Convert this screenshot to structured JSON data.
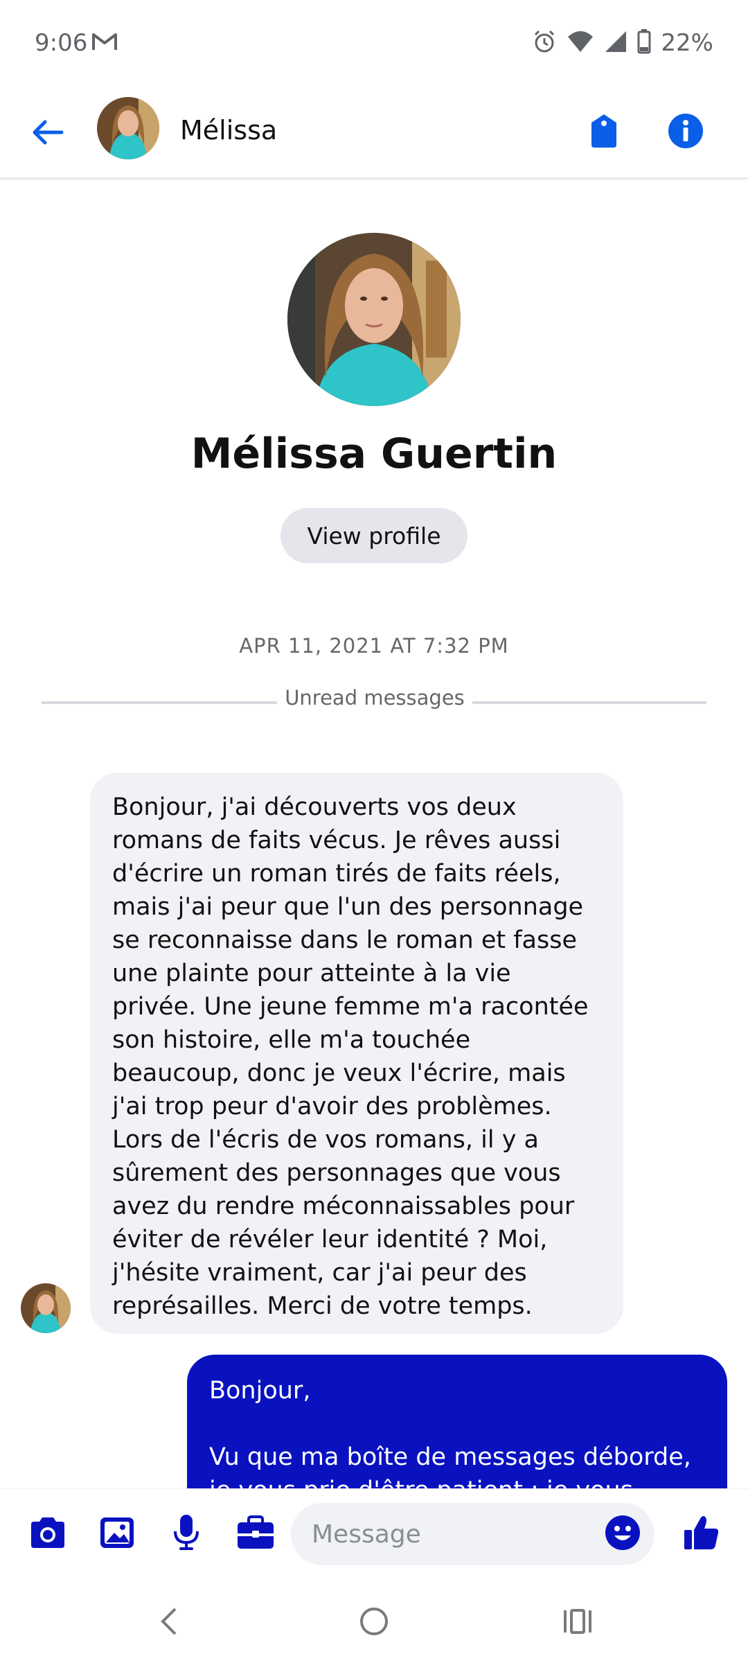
{
  "status_bar": {
    "time": "9:06",
    "battery": "22%",
    "icons": [
      "gmail-icon",
      "alarm-icon",
      "wifi-icon",
      "signal-icon",
      "battery-icon"
    ]
  },
  "header": {
    "contact_name": "Mélissa",
    "icons": [
      "back-arrow-icon",
      "tag-icon",
      "info-icon"
    ]
  },
  "profile": {
    "full_name": "Mélissa Guertin",
    "view_profile_label": "View profile"
  },
  "conversation": {
    "timestamp": "APR 11, 2021 AT 7:32 PM",
    "unread_label": "Unread messages",
    "messages": [
      {
        "direction": "incoming",
        "text": "Bonjour, j'ai découverts vos deux romans de faits vécus. Je rêves aussi d'écrire un roman tirés de faits réels, mais j'ai peur que l'un des personnage se reconnaisse dans le roman et fasse une plainte pour atteinte à la vie privée. Une jeune femme m'a racontée son histoire, elle m'a touchée beaucoup, donc je veux l'écrire, mais j'ai trop peur d'avoir des problèmes. Lors de l'écris de vos romans, il y a sûrement des personnages que vous avez du rendre méconnaissables pour éviter de révéler leur identité ? Moi, j'hésite vraiment, car j'ai peur des représailles. Merci de votre temps."
      },
      {
        "direction": "outgoing",
        "text": "Bonjour,\n\nVu que ma boîte de messages déborde, je vous prie d'être patient ; je vous"
      }
    ]
  },
  "composer": {
    "placeholder": "Message",
    "icons": [
      "camera-icon",
      "image-icon",
      "microphone-icon",
      "briefcase-icon",
      "emoji-icon",
      "thumbs-up-icon"
    ]
  },
  "colors": {
    "accent": "#0a5ee8",
    "outgoing_bubble": "#0a12c0",
    "composer_icons": "#0a12c0",
    "incoming_bubble": "#f1f2f6"
  }
}
